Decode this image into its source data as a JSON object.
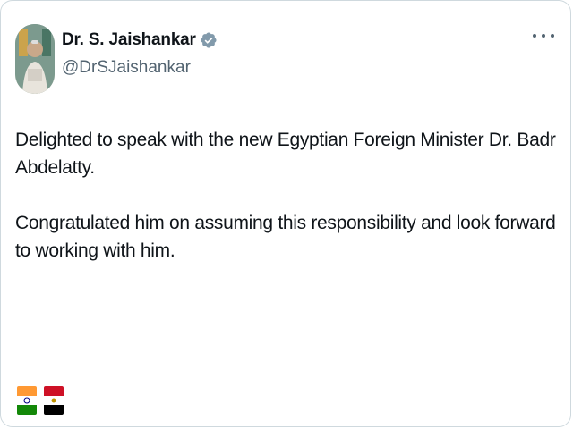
{
  "post": {
    "author": {
      "display_name": "Dr. S. Jaishankar",
      "handle": "@DrSJaishankar",
      "verified": true,
      "verified_color": "#829aab"
    },
    "more_icon": "more-horizontal-icon",
    "paragraphs": [
      "Delighted to speak with the new Egyptian Foreign Minister Dr. Badr Abdelatty.",
      "Congratulated him on assuming this responsibility and look forward to working with him."
    ],
    "flags": [
      {
        "name": "india-flag-icon",
        "colors": [
          "#ff9933",
          "#ffffff",
          "#138808"
        ]
      },
      {
        "name": "egypt-flag-icon",
        "colors": [
          "#ce1126",
          "#ffffff",
          "#000000"
        ]
      }
    ]
  },
  "colors": {
    "text": "#0f1419",
    "secondary": "#536471",
    "border": "#cfd9de"
  }
}
